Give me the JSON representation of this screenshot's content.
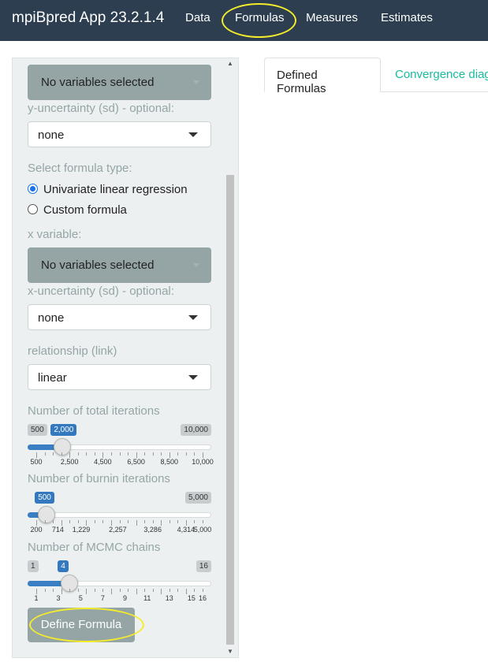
{
  "app": {
    "brand": "mpiBpred App 23.2.1.4",
    "nav": [
      "Data",
      "Formulas",
      "Measures",
      "Estimates"
    ]
  },
  "sidebar": {
    "y_variable_value": "No variables selected",
    "y_uncertainty_label": "y-uncertainty (sd) - optional:",
    "y_uncertainty_value": "none",
    "formula_type_label": "Select formula type:",
    "formula_types": [
      "Univariate linear regression",
      "Custom formula"
    ],
    "formula_type_selected": "Univariate linear regression",
    "x_variable_label": "x variable:",
    "x_variable_value": "No variables selected",
    "x_uncertainty_label": "x-uncertainty (sd) - optional:",
    "x_uncertainty_value": "none",
    "link_label": "relationship (link)",
    "link_value": "linear",
    "iter_label": "Number of total iterations",
    "iter": {
      "min_label": "500",
      "max_label": "10,000",
      "value_label": "2,000",
      "value": 2000,
      "min": 500,
      "max": 10000,
      "ticks": [
        "500",
        "2,500",
        "4,500",
        "6,500",
        "8,500",
        "10,000"
      ]
    },
    "burnin_label": "Number of burnin iterations",
    "burnin": {
      "max_label": "5,000",
      "value_label": "500",
      "value": 500,
      "min": 200,
      "max": 5000,
      "ticks": [
        "200",
        "714",
        "1,229",
        "2,257",
        "3,286",
        "4,314",
        "5,000"
      ]
    },
    "chains_label": "Number of MCMC chains",
    "chains": {
      "min_label": "1",
      "max_label": "16",
      "value_label": "4",
      "value": 4,
      "min": 1,
      "max": 16,
      "ticks": [
        "1",
        "3",
        "5",
        "7",
        "9",
        "11",
        "13",
        "15",
        "16"
      ]
    },
    "define_button": "Define Formula"
  },
  "main": {
    "tabs": [
      "Defined Formulas",
      "Convergence diag"
    ]
  },
  "colors": {
    "navbar": "#2c3e50",
    "accent": "#18bc9c",
    "slider_active": "#3479c0",
    "highlight": "#f4ec2a"
  }
}
